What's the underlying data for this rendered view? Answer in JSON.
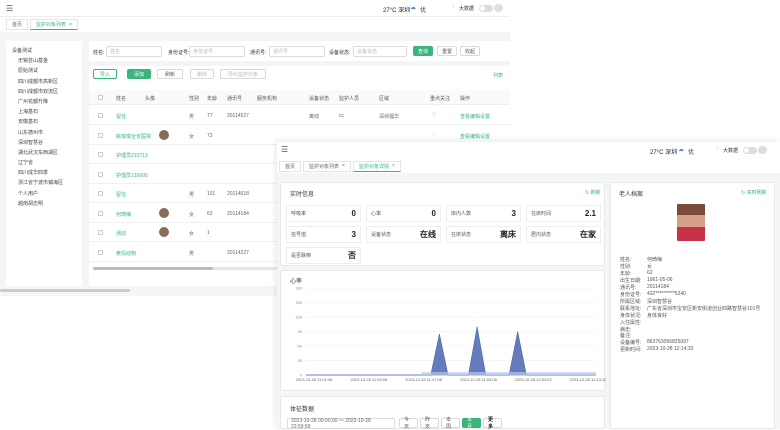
{
  "back": {
    "header": {
      "weather": "27°C 深圳",
      "aq": "优",
      "big_screen": "大数据"
    },
    "tabs": [
      "首页",
      "监护对象列表"
    ],
    "search": {
      "name_label": "姓名:",
      "name_ph": "姓名",
      "id_label": "身份证号:",
      "id_ph": "身份证号",
      "phone_label": "通讯号:",
      "phone_ph": "通讯号",
      "device_label": "设备状态:",
      "device_ph": "设备状态",
      "search_btn": "查询",
      "reset_btn": "重置",
      "collapse_btn": "收起"
    },
    "toolbar": {
      "import": "导入",
      "add": "添加",
      "refresh": "刷新",
      "delete": "删除",
      "export": "导出监护对象",
      "right_link": "列表"
    },
    "columns": [
      "姓名",
      "头像",
      "性别",
      "年龄",
      "通讯号",
      "服务机构",
      "设备状态",
      "监护人员",
      "区域",
      "重点关注",
      "操作"
    ],
    "rows": [
      {
        "name": "留住",
        "gender": "男",
        "age": "77",
        "phone": "20114527",
        "dev": "离线",
        "guard": "cc",
        "area": "深圳福华",
        "flag": "red",
        "op": [
          "查看",
          "编辑",
          "设置"
        ],
        "avatar": false
      },
      {
        "name": "姚琪琪全省医院",
        "gender": "女",
        "age": "73",
        "phone": "",
        "dev": "",
        "guard": "",
        "area": "",
        "flag": "grey",
        "op": [
          "查看",
          "编辑",
          "设置"
        ],
        "avatar": true
      },
      {
        "name": "护理员210713",
        "gender": "",
        "age": "",
        "phone": "",
        "dev": "",
        "guard": "",
        "area": "",
        "flag": "",
        "op": [],
        "avatar": false
      },
      {
        "name": "护理员210605",
        "gender": "",
        "age": "",
        "phone": "",
        "dev": "",
        "guard": "",
        "area": "",
        "flag": "",
        "op": [],
        "avatar": false
      },
      {
        "name": "留住",
        "gender": "男",
        "age": "101",
        "phone": "20114618",
        "dev": "",
        "guard": "",
        "area": "",
        "flag": "",
        "op": [],
        "avatar": false
      },
      {
        "name": "何琦梅",
        "gender": "女",
        "age": "62",
        "phone": "20114184",
        "dev": "",
        "guard": "",
        "area": "",
        "flag": "",
        "op": [],
        "avatar": true
      },
      {
        "name": "测动",
        "gender": "女",
        "age": "1",
        "phone": "",
        "dev": "",
        "guard": "",
        "area": "",
        "flag": "",
        "op": [],
        "avatar": true
      },
      {
        "name": "黄玛动物",
        "gender": "男",
        "age": "",
        "phone": "20114227",
        "dev": "",
        "guard": "",
        "area": "",
        "flag": "",
        "op": [],
        "avatar": false
      }
    ],
    "tree": [
      "设备测试",
      "无锡芸山基金",
      "原始测试",
      "四川成都市高新区",
      "四川成都市双流区",
      "广州花都升降",
      "上海基石",
      "安徽基石",
      "山东德州市",
      "深圳智慧谷",
      "湖北武汉东西湖区",
      "辽宁省",
      "四川成华四季",
      "浙江省宁波市镇海区",
      "个人用户",
      "越南胡志明"
    ]
  },
  "front": {
    "header": {
      "weather": "27°C 深圳",
      "aq": "优",
      "big_screen": "大数据"
    },
    "tabs": [
      "首页",
      "监护对象列表",
      "监护对象详情"
    ],
    "realtime": {
      "title": "实时信息",
      "refresh": "刷新",
      "stats": [
        {
          "label": "呼吸率",
          "value": "0"
        },
        {
          "label": "心率",
          "value": "0"
        },
        {
          "label": "床内人数",
          "value": "3"
        },
        {
          "label": "在床时间",
          "value": "2.1"
        },
        {
          "label": "信号值",
          "value": "3"
        },
        {
          "label": "设备状态",
          "value": "在线"
        },
        {
          "label": "在床状态",
          "value": "离床"
        },
        {
          "label": "居内状态",
          "value": "在家"
        },
        {
          "label": "是否跌倒",
          "value": "否"
        }
      ]
    },
    "chart_title": "心率",
    "vitals": {
      "title": "体征数据",
      "range": "2023-10-28 00:00:00  ～  2023-10-28 23:59:59",
      "btns": [
        "今天",
        "昨天",
        "本周",
        "本月",
        "更多"
      ]
    },
    "profile": {
      "title": "老人档案",
      "refresh": "实时刷新",
      "fields": [
        {
          "k": "姓名:",
          "v": "何琦梅"
        },
        {
          "k": "性别:",
          "v": "女"
        },
        {
          "k": "年龄:",
          "v": "62"
        },
        {
          "k": "出生日期:",
          "v": "1961-05-06"
        },
        {
          "k": "通讯号:",
          "v": "20114184"
        },
        {
          "k": "身份证号:",
          "v": "432**********5240"
        },
        {
          "k": "所属区域:",
          "v": "深圳智慧谷"
        },
        {
          "k": "联系地址:",
          "v": "广东省深圳市宝安区新安街道创业四路智慧谷101号"
        },
        {
          "k": "身体状况:",
          "v": "身体良好"
        },
        {
          "k": "入住属性:",
          "v": ""
        },
        {
          "k": "病史:",
          "v": ""
        },
        {
          "k": "备注:",
          "v": ""
        },
        {
          "k": "设备编号:",
          "v": "863763056825097"
        },
        {
          "k": "更新时间:",
          "v": "2023-10-28 12:14:32"
        }
      ]
    }
  },
  "chart_data": {
    "type": "area",
    "ylabel": "心率",
    "ylim": [
      0,
      180
    ],
    "yticks": [
      0,
      30,
      60,
      90,
      120,
      150,
      180
    ],
    "xticks": [
      "2023-10-28 11:01:08",
      "2023-10-28 11:03:08",
      "2023-10-28 11:47:08",
      "2023-10-28 11:53:08",
      "2023-10-28 12:04:02",
      "2023-10-28 12:13:32"
    ],
    "x": [
      0,
      0.43,
      0.46,
      0.49,
      0.56,
      0.59,
      0.62,
      0.7,
      0.73,
      0.76,
      0.86,
      1.0
    ],
    "y": [
      0,
      0,
      85,
      0,
      0,
      100,
      0,
      0,
      90,
      0,
      0,
      0
    ],
    "grid": true
  }
}
